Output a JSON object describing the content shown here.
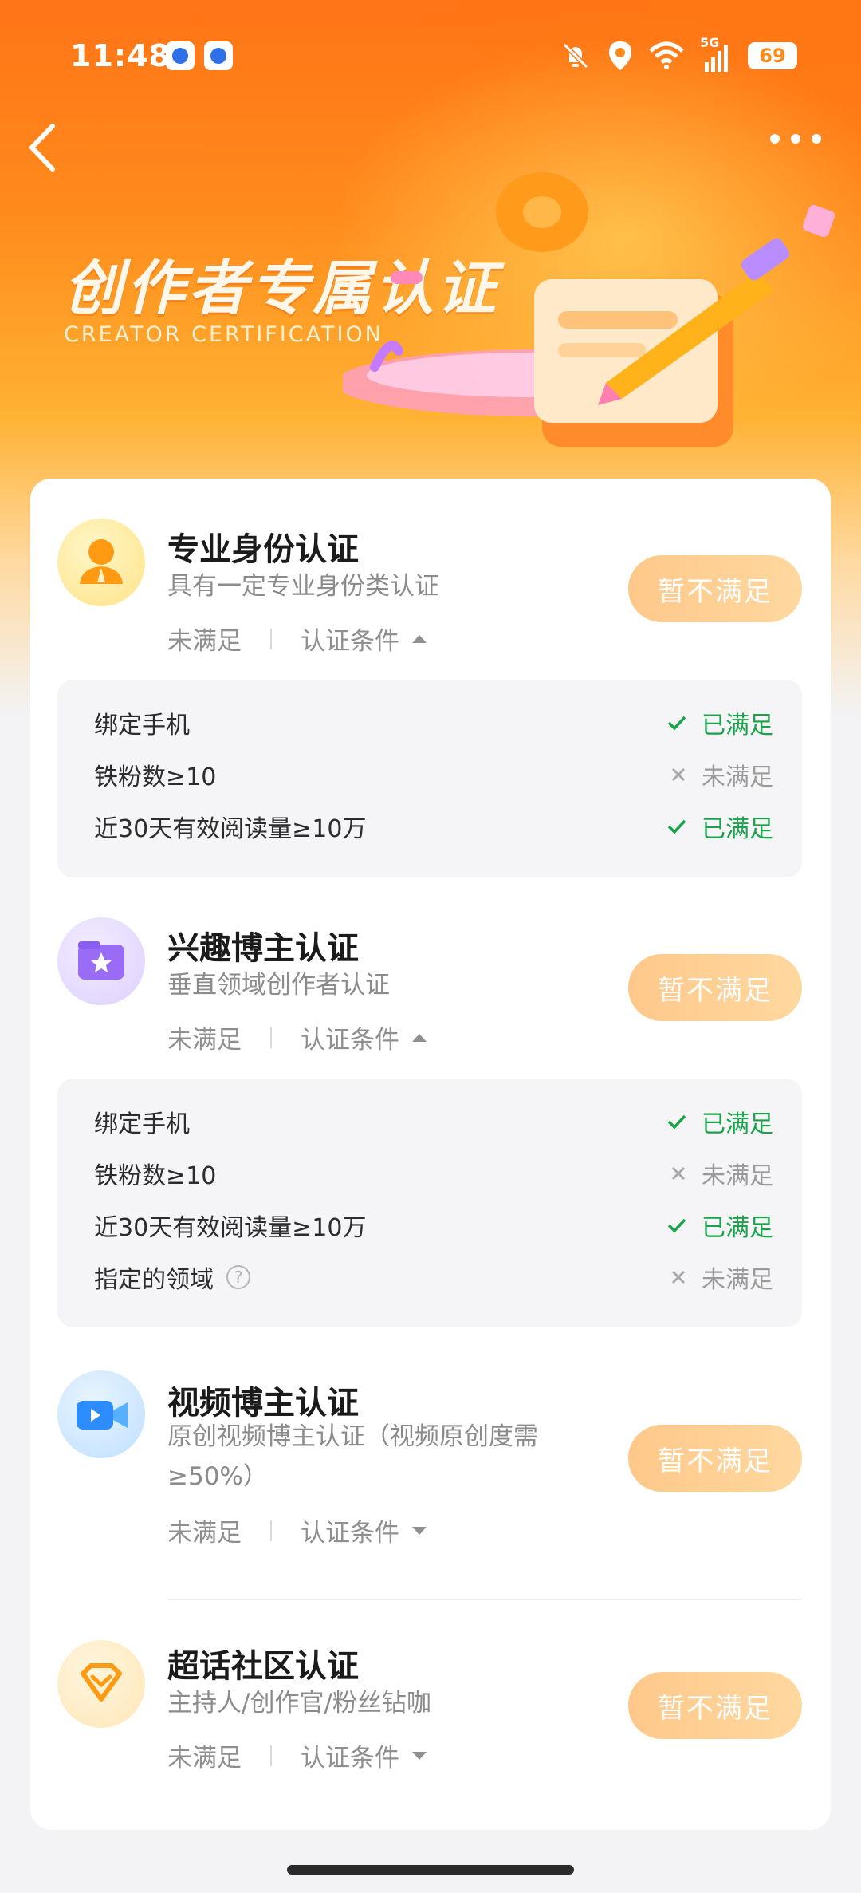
{
  "status_bar": {
    "time": "11:48",
    "battery": "69",
    "network": "5G"
  },
  "banner": {
    "title": "创作者专属认证",
    "subtitle": "CREATOR CERTIFICATION"
  },
  "sections": [
    {
      "title": "专业身份认证",
      "desc": "具有一定专业身份类认证",
      "status": "未满足",
      "conditions_label": "认证条件",
      "button": "暂不满足",
      "conditions": [
        {
          "label": "绑定手机",
          "status": "已满足"
        },
        {
          "label": "铁粉数≥10",
          "status": "未满足"
        },
        {
          "label": "近30天有效阅读量≥10万",
          "status": "已满足"
        }
      ]
    },
    {
      "title": "兴趣博主认证",
      "desc": "垂直领域创作者认证",
      "status": "未满足",
      "conditions_label": "认证条件",
      "button": "暂不满足",
      "conditions": [
        {
          "label": "绑定手机",
          "status": "已满足"
        },
        {
          "label": "铁粉数≥10",
          "status": "未满足"
        },
        {
          "label": "近30天有效阅读量≥10万",
          "status": "已满足"
        },
        {
          "label": "指定的领域",
          "status": "未满足"
        }
      ]
    },
    {
      "title": "视频博主认证",
      "desc": "原创视频博主认证（视频原创度需≥50%）",
      "status": "未满足",
      "conditions_label": "认证条件",
      "button": "暂不满足"
    },
    {
      "title": "超话社区认证",
      "desc": "主持人/创作官/粉丝钻咖",
      "status": "未满足",
      "conditions_label": "认证条件",
      "button": "暂不满足"
    }
  ],
  "colors": {
    "accent": "#ff7a1a",
    "satisfied": "#1aa34a",
    "unsatisfied": "#9a9a9a",
    "button": "#ffcf94"
  },
  "icons": {
    "back": "back-arrow-icon",
    "more": "more-dots-icon",
    "check": "check-icon",
    "cross": "cross-icon",
    "help": "question-icon"
  }
}
